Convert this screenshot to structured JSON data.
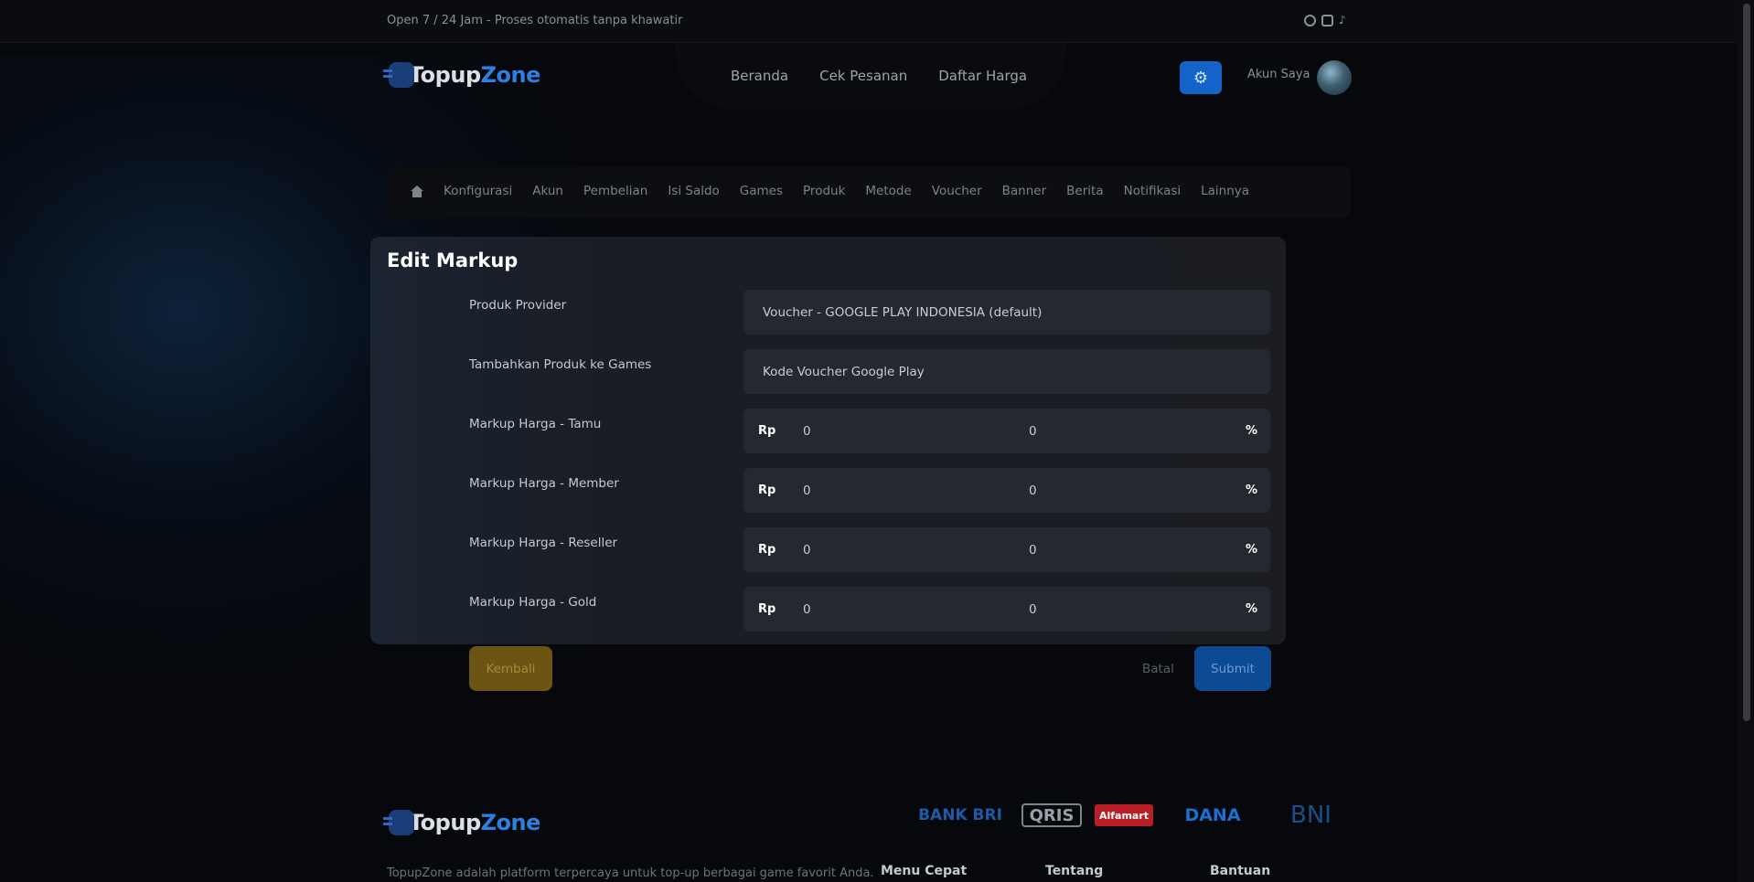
{
  "topbar": {
    "tagline": "Open 7 / 24 Jam - Proses otomatis tanpa khawatir",
    "social_icons": [
      "whatsapp-icon",
      "instagram-icon",
      "tiktok-icon"
    ]
  },
  "brand": {
    "name_part1": "Topup",
    "name_part2": "Z",
    "name_part3": "o",
    "name_part4": "ne"
  },
  "nav": {
    "items": [
      "Beranda",
      "Cek Pesanan",
      "Daftar Harga"
    ],
    "account_label": "Akun Saya"
  },
  "subnav": {
    "items": [
      "Konfigurasi",
      "Akun",
      "Pembelian",
      "Isi Saldo",
      "Games",
      "Produk",
      "Metode",
      "Voucher",
      "Banner",
      "Berita",
      "Notifikasi",
      "Lainnya"
    ]
  },
  "form": {
    "title": "Edit Markup",
    "provider_label": "Produk Provider",
    "provider_value": "Voucher - GOOGLE PLAY INDONESIA (default)",
    "game_label": "Tambahkan Produk ke Games",
    "game_value": "Kode Voucher Google Play",
    "currency_prefix": "Rp",
    "percent_suffix": "%",
    "markups": [
      {
        "label": "Markup Harga - Tamu",
        "rp": "0",
        "percent": "0"
      },
      {
        "label": "Markup Harga - Member",
        "rp": "0",
        "percent": "0"
      },
      {
        "label": "Markup Harga - Reseller",
        "rp": "0",
        "percent": "0"
      },
      {
        "label": "Markup Harga - Gold",
        "rp": "0",
        "percent": "0"
      }
    ],
    "back_label": "Kembali",
    "cancel_label": "Batal",
    "submit_label": "Submit"
  },
  "footer": {
    "payments": [
      "BANK BRI",
      "QRIS",
      "Alfamart",
      "DANA",
      "BNI"
    ],
    "description": "TopupZone adalah platform terpercaya untuk top-up berbagai game favorit Anda.",
    "columns": [
      "Menu Cepat",
      "Tentang",
      "Bantuan"
    ]
  },
  "colors": {
    "accent": "#1463c9",
    "back_button": "#6c5512",
    "submit_button": "#0d4a94"
  }
}
